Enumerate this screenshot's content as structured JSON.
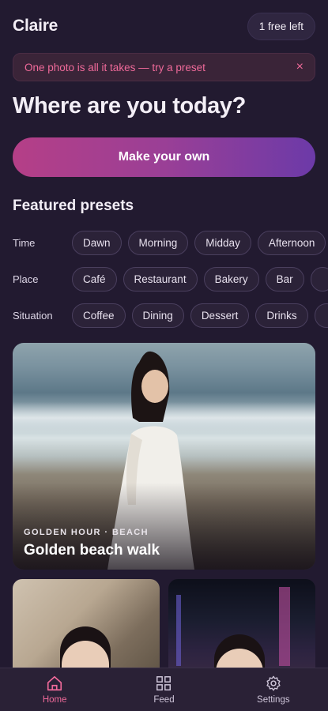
{
  "header": {
    "user_name": "Claire",
    "credits_label": "1 free left"
  },
  "banner": {
    "text": "One photo is all it takes — try a preset",
    "close_glyph": "×"
  },
  "headline": "Where are you today?",
  "cta_label": "Make your own",
  "presets": {
    "title": "Featured presets",
    "rows": [
      {
        "label": "Time",
        "chips": [
          "Dawn",
          "Morning",
          "Midday",
          "Afternoon"
        ]
      },
      {
        "label": "Place",
        "chips": [
          "Café",
          "Restaurant",
          "Bakery",
          "Bar"
        ]
      },
      {
        "label": "Situation",
        "chips": [
          "Coffee",
          "Dining",
          "Dessert",
          "Drinks"
        ]
      }
    ]
  },
  "featured_card": {
    "eyebrow": "GOLDEN HOUR · BEACH",
    "title": "Golden beach walk"
  },
  "nav": {
    "items": [
      {
        "label": "Home",
        "icon": "home-icon",
        "active": true
      },
      {
        "label": "Feed",
        "icon": "grid-icon",
        "active": false
      },
      {
        "label": "Settings",
        "icon": "gear-icon",
        "active": false
      }
    ]
  },
  "colors": {
    "background": "#221a30",
    "accent": "#f06a9a",
    "cta_start": "#b53f87",
    "cta_end": "#6c3aa8"
  }
}
